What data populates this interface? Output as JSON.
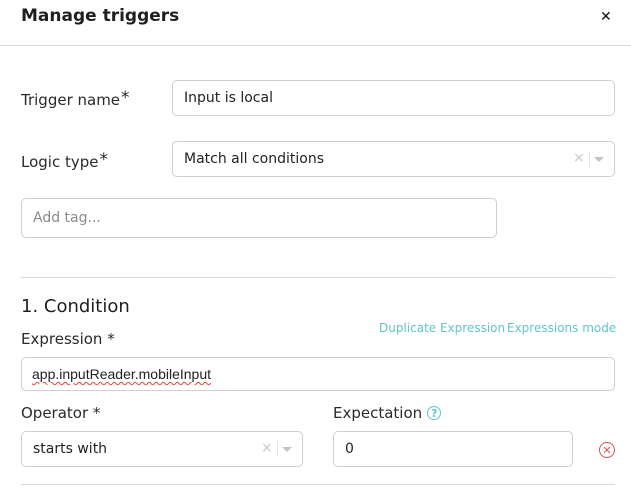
{
  "dialog": {
    "title": "Manage triggers",
    "close_label": "✕"
  },
  "form": {
    "trigger_name": {
      "label": "Trigger name",
      "required_mark": "*",
      "value": "Input is local"
    },
    "logic_type": {
      "label": "Logic type",
      "required_mark": "*",
      "value": "Match all conditions"
    },
    "tags": {
      "placeholder": "Add tag..."
    }
  },
  "condition": {
    "title": "1. Condition",
    "expression": {
      "label": "Expression *",
      "value": "app.inputReader.mobileInput",
      "duplicate_link": "Duplicate Expression",
      "mode_link": "Expressions mode"
    },
    "operator": {
      "label": "Operator *",
      "value": "starts with"
    },
    "expectation": {
      "label": "Expectation",
      "value": "0",
      "help_icon": "?"
    }
  },
  "icons": {
    "clear": "×",
    "remove": "✕"
  },
  "colors": {
    "accent": "#5fc6cc",
    "danger": "#d9534f",
    "border": "#cfcfcf"
  }
}
